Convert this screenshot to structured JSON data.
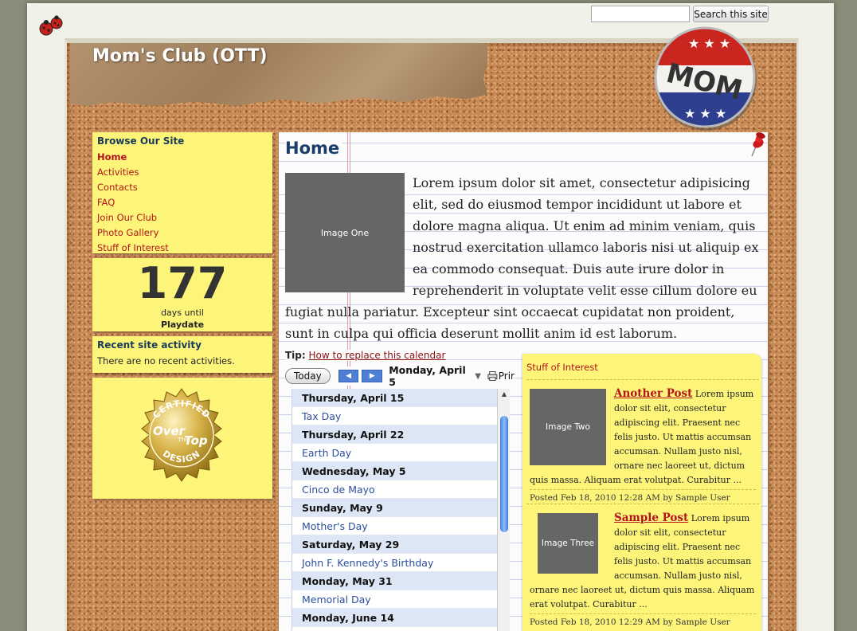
{
  "search": {
    "placeholder": "",
    "button_label": "Search this site"
  },
  "site": {
    "title": "Mom's Club (OTT)",
    "badge_text": "MOM"
  },
  "sidebar": {
    "browse_heading": "Browse Our Site",
    "items": [
      {
        "label": "Home"
      },
      {
        "label": "Activities"
      },
      {
        "label": "Contacts"
      },
      {
        "label": "FAQ"
      },
      {
        "label": "Join Our Club"
      },
      {
        "label": "Photo Gallery"
      },
      {
        "label": "Stuff of Interest"
      }
    ],
    "countdown": {
      "number": "177",
      "label": "days until",
      "event": "Playdate"
    },
    "activity": {
      "heading": "Recent site activity",
      "text": "There are no recent activities."
    },
    "seal_text": {
      "top": "CERTIFIED",
      "over": "Over",
      "the": "The",
      "top_word": "Top",
      "bottom": "DESIGN"
    }
  },
  "main": {
    "title": "Home",
    "image_label": "Image One",
    "body": "Lorem ipsum dolor sit amet, consectetur adipisicing elit, sed do eiusmod tempor incididunt ut labore et dolore magna aliqua. Ut enim ad minim veniam, quis nostrud exercitation ullamco laboris nisi ut aliquip ex ea commodo consequat. Duis aute irure dolor in reprehenderit in voluptate velit esse cillum dolore eu fugiat nulla pariatur. Excepteur sint occaecat cupidatat non proident, sunt in culpa qui officia deserunt mollit anim id est laborum.",
    "tip_label": "Tip:",
    "tip_link": "How to replace this calendar"
  },
  "calendar": {
    "today_label": "Today",
    "prev_icon": "left-arrow-icon",
    "next_icon": "right-arrow-icon",
    "current_date": "Monday, April 5",
    "print_label": "Prir",
    "rows": [
      {
        "kind": "day",
        "text": "Thursday, April 15"
      },
      {
        "kind": "event",
        "text": "Tax Day"
      },
      {
        "kind": "day",
        "text": "Thursday, April 22"
      },
      {
        "kind": "event",
        "text": "Earth Day"
      },
      {
        "kind": "day",
        "text": "Wednesday, May 5"
      },
      {
        "kind": "event",
        "text": "Cinco de Mayo"
      },
      {
        "kind": "day",
        "text": "Sunday, May 9"
      },
      {
        "kind": "event",
        "text": "Mother's Day"
      },
      {
        "kind": "day",
        "text": "Saturday, May 29"
      },
      {
        "kind": "event",
        "text": "John F. Kennedy's Birthday"
      },
      {
        "kind": "day",
        "text": "Monday, May 31"
      },
      {
        "kind": "event",
        "text": "Memorial Day"
      },
      {
        "kind": "day",
        "text": "Monday, June 14"
      }
    ]
  },
  "interest": {
    "heading": "Stuff of Interest",
    "posts": [
      {
        "image_label": "Image Two",
        "title": "Another Post",
        "excerpt": " Lorem ipsum dolor sit elit, consectetur adipiscing elit. Praesent nec felis justo. Ut mattis accumsan accumsan. Nullam justo nisl, ornare nec laoreet ut, dictum quis massa. Aliquam erat volutpat. Curabitur ...",
        "meta": "Posted Feb 18, 2010 12:28 AM by Sample User"
      },
      {
        "image_label": "Image Three",
        "title": "Sample Post",
        "excerpt": " Lorem ipsum dolor sit elit, consectetur adipiscing elit. Praesent nec felis justo. Ut mattis accumsan accumsan. Nullam justo nisl, ornare nec laoreet ut, dictum quis massa. Aliquam erat volutpat. Curabitur ...",
        "meta": "Posted Feb 18, 2010 12:29 AM by Sample User"
      }
    ]
  },
  "colors": {
    "cork": "#c88a55",
    "sticky_note": "#fdf57a",
    "link_red": "#b3141c",
    "heading_blue": "#1a3d6a",
    "calendar_day_bg": "#dde6f4",
    "calendar_event_text": "#2c4f9c"
  }
}
